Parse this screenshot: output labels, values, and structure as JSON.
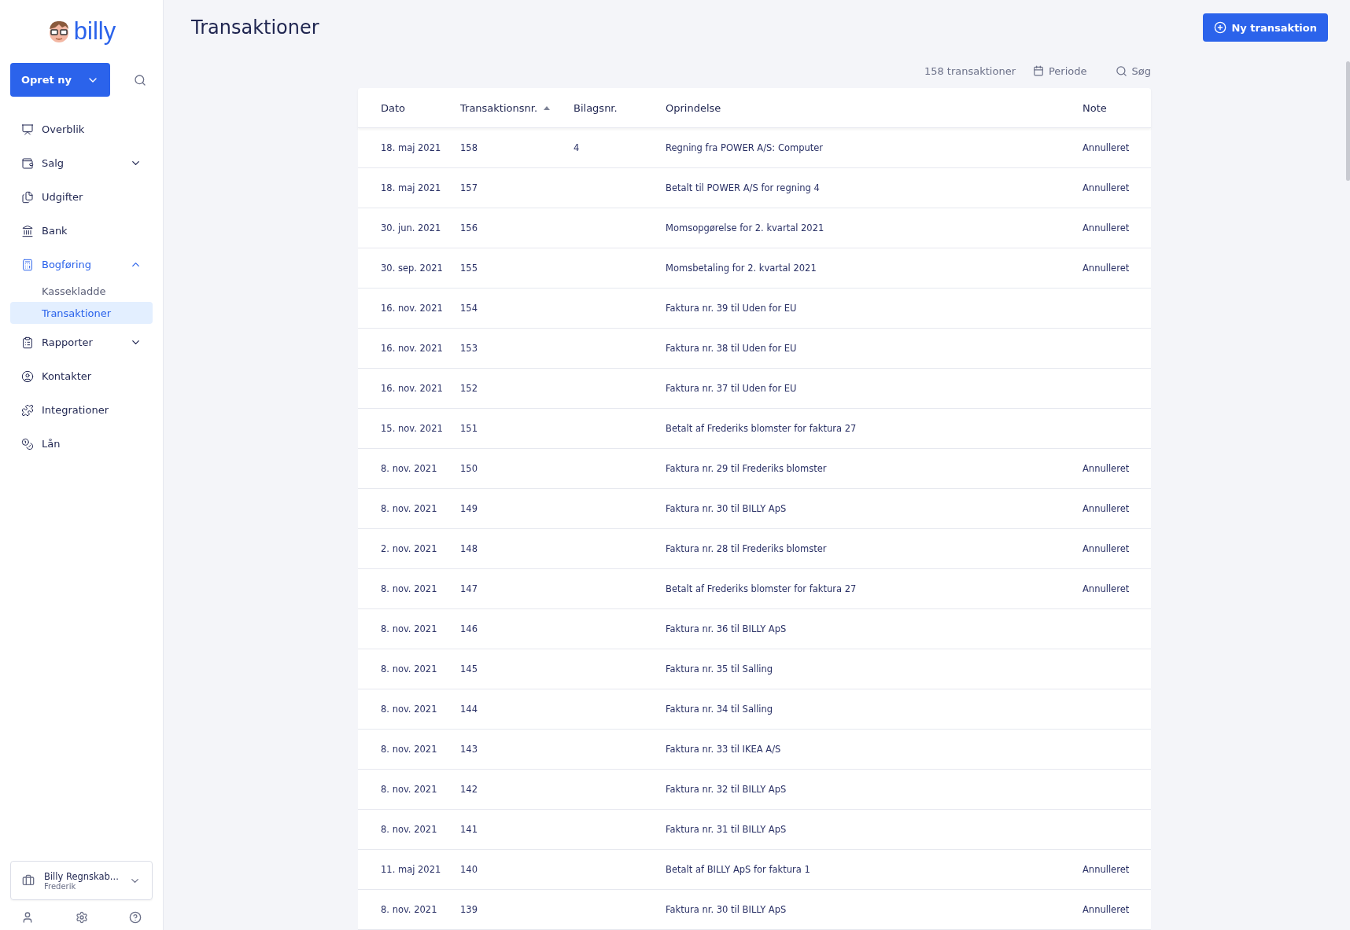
{
  "logo": {
    "text": "billy"
  },
  "create_button": {
    "label": "Opret ny"
  },
  "sidebar": {
    "items": [
      {
        "label": "Overblik",
        "selected": false
      },
      {
        "label": "Salg",
        "selected": false,
        "expanded": false
      },
      {
        "label": "Udgifter",
        "selected": false
      },
      {
        "label": "Bank",
        "selected": false
      },
      {
        "label": "Bogføring",
        "selected": true,
        "expanded": true,
        "children": [
          {
            "label": "Kassekladde",
            "selected": false
          },
          {
            "label": "Transaktioner",
            "selected": true
          }
        ]
      },
      {
        "label": "Rapporter",
        "selected": false,
        "expanded": false
      },
      {
        "label": "Kontakter",
        "selected": false
      },
      {
        "label": "Integrationer",
        "selected": false
      },
      {
        "label": "Lån",
        "selected": false
      }
    ]
  },
  "organization": {
    "name": "Billy Regnskab...",
    "user": "Frederik"
  },
  "page_title": "Transaktioner",
  "new_button": {
    "label": "Ny transaktion"
  },
  "toolbar": {
    "count": "158 transaktioner",
    "period": "Periode",
    "search": "Søg"
  },
  "table": {
    "columns": [
      {
        "label": "Dato",
        "sorted": false
      },
      {
        "label": "Transaktionsnr.",
        "sorted": true
      },
      {
        "label": "Bilagsnr.",
        "sorted": false
      },
      {
        "label": "Oprindelse",
        "sorted": false
      },
      {
        "label": "Note",
        "sorted": false
      }
    ],
    "rows": [
      [
        "18. maj 2021",
        "158",
        "4",
        "Regning fra POWER A/S: Computer",
        "Annulleret"
      ],
      [
        "18. maj 2021",
        "157",
        "",
        "Betalt til POWER A/S for regning 4",
        "Annulleret"
      ],
      [
        "30. jun. 2021",
        "156",
        "",
        "Momsopgørelse for 2. kvartal 2021",
        "Annulleret"
      ],
      [
        "30. sep. 2021",
        "155",
        "",
        "Momsbetaling for 2. kvartal 2021",
        "Annulleret"
      ],
      [
        "16. nov. 2021",
        "154",
        "",
        "Faktura nr. 39 til Uden for EU",
        ""
      ],
      [
        "16. nov. 2021",
        "153",
        "",
        "Faktura nr. 38 til Uden for EU",
        ""
      ],
      [
        "16. nov. 2021",
        "152",
        "",
        "Faktura nr. 37 til Uden for EU",
        ""
      ],
      [
        "15. nov. 2021",
        "151",
        "",
        "Betalt af Frederiks blomster for faktura 27",
        ""
      ],
      [
        "8. nov. 2021",
        "150",
        "",
        "Faktura nr. 29 til Frederiks blomster",
        "Annulleret"
      ],
      [
        "8. nov. 2021",
        "149",
        "",
        "Faktura nr. 30 til BILLY ApS",
        "Annulleret"
      ],
      [
        "2. nov. 2021",
        "148",
        "",
        "Faktura nr. 28 til Frederiks blomster",
        "Annulleret"
      ],
      [
        "8. nov. 2021",
        "147",
        "",
        "Betalt af Frederiks blomster for faktura 27",
        "Annulleret"
      ],
      [
        "8. nov. 2021",
        "146",
        "",
        "Faktura nr. 36 til BILLY ApS",
        ""
      ],
      [
        "8. nov. 2021",
        "145",
        "",
        "Faktura nr. 35 til Salling",
        ""
      ],
      [
        "8. nov. 2021",
        "144",
        "",
        "Faktura nr. 34 til Salling",
        ""
      ],
      [
        "8. nov. 2021",
        "143",
        "",
        "Faktura nr. 33 til IKEA A/S",
        ""
      ],
      [
        "8. nov. 2021",
        "142",
        "",
        "Faktura nr. 32 til BILLY ApS",
        ""
      ],
      [
        "8. nov. 2021",
        "141",
        "",
        "Faktura nr. 31 til BILLY ApS",
        ""
      ],
      [
        "11. maj 2021",
        "140",
        "",
        "Betalt af BILLY ApS for faktura 1",
        "Annulleret"
      ],
      [
        "8. nov. 2021",
        "139",
        "",
        "Faktura nr. 30 til BILLY ApS",
        "Annulleret"
      ]
    ]
  }
}
